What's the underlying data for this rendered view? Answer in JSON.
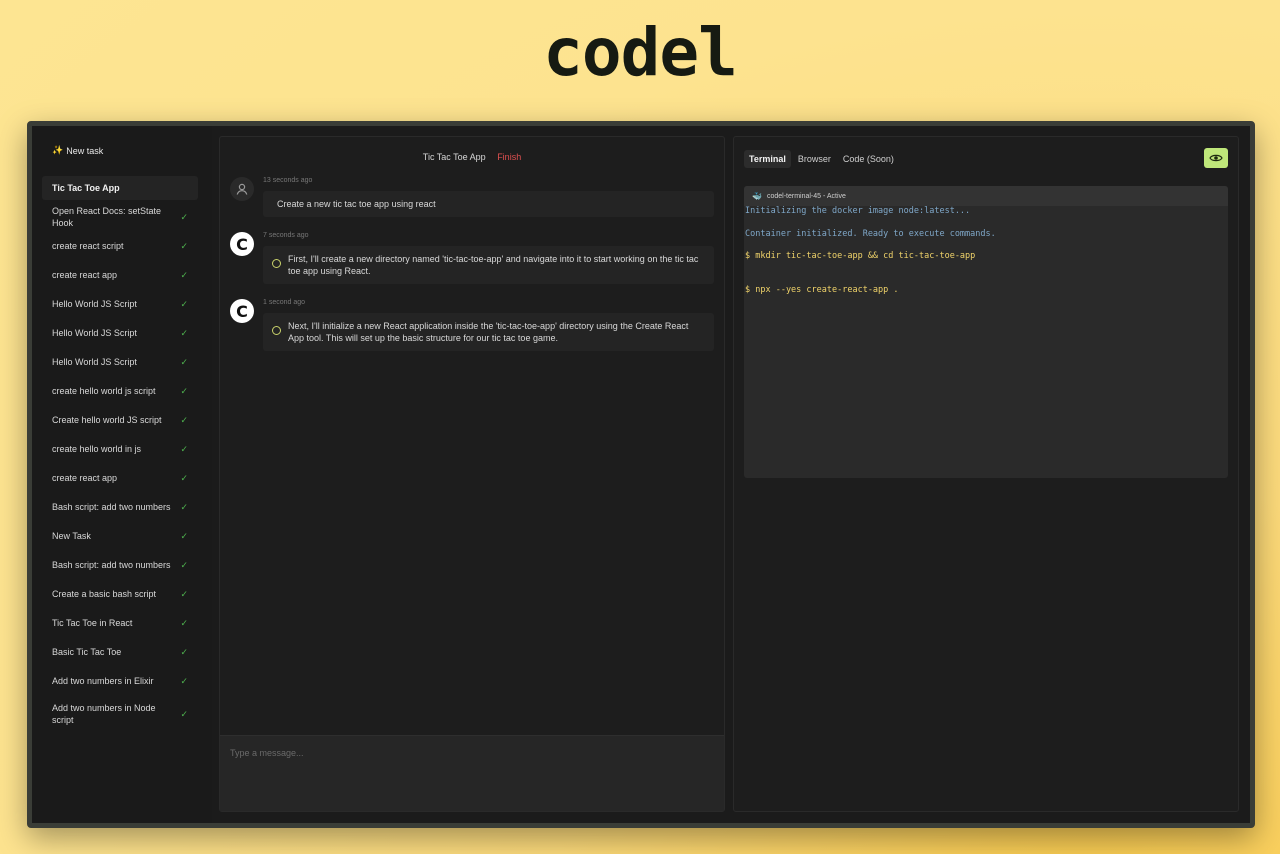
{
  "logo": "codel",
  "sidebar": {
    "new_task_label": "New task",
    "items": [
      {
        "label": "Tic Tac Toe App",
        "done": false
      },
      {
        "label": "Open React Docs: setState Hook",
        "done": true
      },
      {
        "label": "create react script",
        "done": true
      },
      {
        "label": "create react app",
        "done": true
      },
      {
        "label": "Hello World JS Script",
        "done": true
      },
      {
        "label": "Hello World JS Script",
        "done": true
      },
      {
        "label": "Hello World JS Script",
        "done": true
      },
      {
        "label": "create hello world js script",
        "done": true
      },
      {
        "label": "Create hello world JS script",
        "done": true
      },
      {
        "label": "create hello world in js",
        "done": true
      },
      {
        "label": "create react app",
        "done": true
      },
      {
        "label": "Bash script: add two numbers",
        "done": true
      },
      {
        "label": "New Task",
        "done": true
      },
      {
        "label": "Bash script: add two numbers",
        "done": true
      },
      {
        "label": "Create a basic bash script",
        "done": true
      },
      {
        "label": "Tic Tac Toe in React",
        "done": true
      },
      {
        "label": "Basic Tic Tac Toe",
        "done": true
      },
      {
        "label": "Add two numbers in Elixir",
        "done": true
      },
      {
        "label": "Add two numbers in Node script",
        "done": true
      }
    ]
  },
  "chat": {
    "title": "Tic Tac Toe App",
    "status": "Finish",
    "messages": [
      {
        "role": "user",
        "time": "13 seconds ago",
        "text": "Create a new tic tac toe app using react"
      },
      {
        "role": "bot",
        "avatar": "C",
        "time": "7 seconds ago",
        "text": "First, I'll create a new directory named 'tic-tac-toe-app' and navigate into it to start working on the tic tac toe app using React."
      },
      {
        "role": "bot",
        "avatar": "C",
        "time": "1 second ago",
        "text": "Next, I'll initialize a new React application inside the 'tic-tac-toe-app' directory using the Create React App tool. This will set up the basic structure for our tic tac toe game."
      }
    ],
    "input_placeholder": "Type a message..."
  },
  "panel": {
    "tabs": [
      "Terminal",
      "Browser",
      "Code (Soon)"
    ],
    "active_tab": "Terminal",
    "terminal": {
      "title": "codel-terminal-45 - Active",
      "lines": [
        {
          "kind": "info",
          "text": "Initializing the docker image node:latest..."
        },
        {
          "kind": "info",
          "text": "Container initialized. Ready to execute commands."
        },
        {
          "kind": "cmd",
          "text": "$ mkdir tic-tac-toe-app && cd tic-tac-toe-app"
        },
        {
          "kind": "blank",
          "text": ""
        },
        {
          "kind": "cmd",
          "text": "$ npx --yes create-react-app ."
        }
      ]
    },
    "accent_color": "#bfe77a"
  }
}
